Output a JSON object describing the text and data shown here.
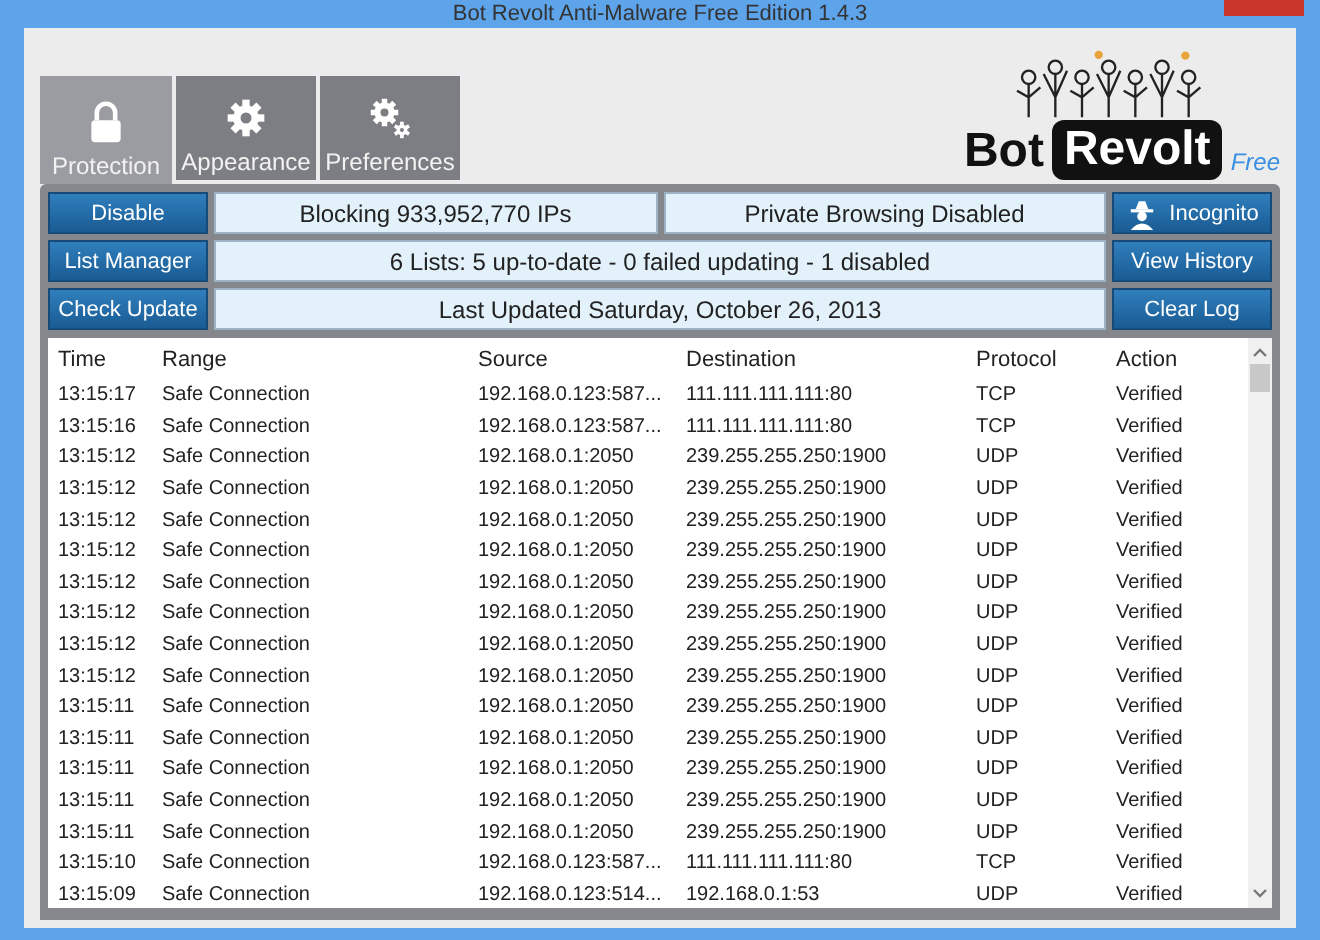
{
  "window": {
    "title": "Bot Revolt Anti-Malware Free Edition 1.4.3"
  },
  "tabs": [
    {
      "label": "Protection",
      "kind": "lock",
      "selected": true
    },
    {
      "label": "Appearance",
      "kind": "gear",
      "selected": false
    },
    {
      "label": "Preferences",
      "kind": "gears",
      "selected": false
    }
  ],
  "logo": {
    "word_1": "Bot",
    "word_2": "Revolt",
    "edition": "Free"
  },
  "controls": {
    "left_buttons": [
      "Disable",
      "List Manager",
      "Check Update"
    ],
    "right_buttons": [
      {
        "label": "Incognito",
        "kind": "spy"
      },
      {
        "label": "View History",
        "kind": "plain"
      },
      {
        "label": "Clear Log",
        "kind": "plain"
      }
    ],
    "blocking": "Blocking 933,952,770 IPs",
    "private_browsing": "Private Browsing Disabled",
    "lists_status": "6 Lists: 5 up-to-date - 0 failed updating - 1 disabled",
    "last_updated": "Last Updated Saturday, October 26, 2013"
  },
  "table": {
    "columns": [
      "Time",
      "Range",
      "Source",
      "Destination",
      "Protocol",
      "Action"
    ],
    "rows": [
      [
        "13:15:17",
        "Safe Connection",
        "192.168.0.123:587...",
        "111.111.111.111:80",
        "TCP",
        "Verified"
      ],
      [
        "13:15:16",
        "Safe Connection",
        "192.168.0.123:587...",
        "111.111.111.111:80",
        "TCP",
        "Verified"
      ],
      [
        "13:15:12",
        "Safe Connection",
        "192.168.0.1:2050",
        "239.255.255.250:1900",
        "UDP",
        "Verified"
      ],
      [
        "13:15:12",
        "Safe Connection",
        "192.168.0.1:2050",
        "239.255.255.250:1900",
        "UDP",
        "Verified"
      ],
      [
        "13:15:12",
        "Safe Connection",
        "192.168.0.1:2050",
        "239.255.255.250:1900",
        "UDP",
        "Verified"
      ],
      [
        "13:15:12",
        "Safe Connection",
        "192.168.0.1:2050",
        "239.255.255.250:1900",
        "UDP",
        "Verified"
      ],
      [
        "13:15:12",
        "Safe Connection",
        "192.168.0.1:2050",
        "239.255.255.250:1900",
        "UDP",
        "Verified"
      ],
      [
        "13:15:12",
        "Safe Connection",
        "192.168.0.1:2050",
        "239.255.255.250:1900",
        "UDP",
        "Verified"
      ],
      [
        "13:15:12",
        "Safe Connection",
        "192.168.0.1:2050",
        "239.255.255.250:1900",
        "UDP",
        "Verified"
      ],
      [
        "13:15:12",
        "Safe Connection",
        "192.168.0.1:2050",
        "239.255.255.250:1900",
        "UDP",
        "Verified"
      ],
      [
        "13:15:11",
        "Safe Connection",
        "192.168.0.1:2050",
        "239.255.255.250:1900",
        "UDP",
        "Verified"
      ],
      [
        "13:15:11",
        "Safe Connection",
        "192.168.0.1:2050",
        "239.255.255.250:1900",
        "UDP",
        "Verified"
      ],
      [
        "13:15:11",
        "Safe Connection",
        "192.168.0.1:2050",
        "239.255.255.250:1900",
        "UDP",
        "Verified"
      ],
      [
        "13:15:11",
        "Safe Connection",
        "192.168.0.1:2050",
        "239.255.255.250:1900",
        "UDP",
        "Verified"
      ],
      [
        "13:15:11",
        "Safe Connection",
        "192.168.0.1:2050",
        "239.255.255.250:1900",
        "UDP",
        "Verified"
      ],
      [
        "13:15:10",
        "Safe Connection",
        "192.168.0.123:587...",
        "111.111.111.111:80",
        "TCP",
        "Verified"
      ],
      [
        "13:15:09",
        "Safe Connection",
        "192.168.0.123:514...",
        "192.168.0.1:53",
        "UDP",
        "Verified"
      ]
    ]
  }
}
